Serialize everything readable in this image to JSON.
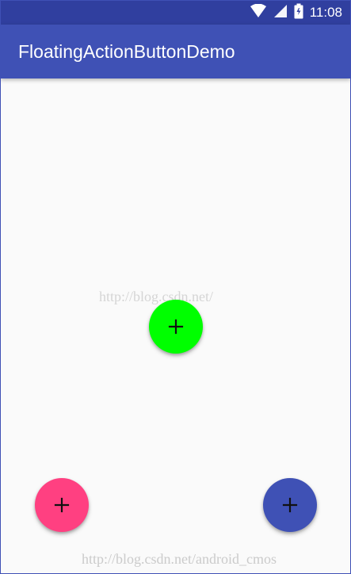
{
  "status_bar": {
    "time": "11:08",
    "icons": [
      "wifi-icon",
      "signal-icon",
      "battery-icon"
    ]
  },
  "app_bar": {
    "title": "FloatingActionButtonDemo"
  },
  "watermarks": {
    "center": "http://blog.csdn.net/",
    "bottom": "http://blog.csdn.net/android_cmos"
  },
  "fabs": [
    {
      "name": "fab-center",
      "icon": "plus-icon",
      "color": "#00ff00"
    },
    {
      "name": "fab-left",
      "icon": "plus-icon",
      "color": "#ff4081"
    },
    {
      "name": "fab-right",
      "icon": "plus-icon",
      "color": "#3f51b5"
    }
  ],
  "colors": {
    "status_bar": "#303f9f",
    "app_bar": "#3f51b5",
    "background": "#fafafa"
  }
}
